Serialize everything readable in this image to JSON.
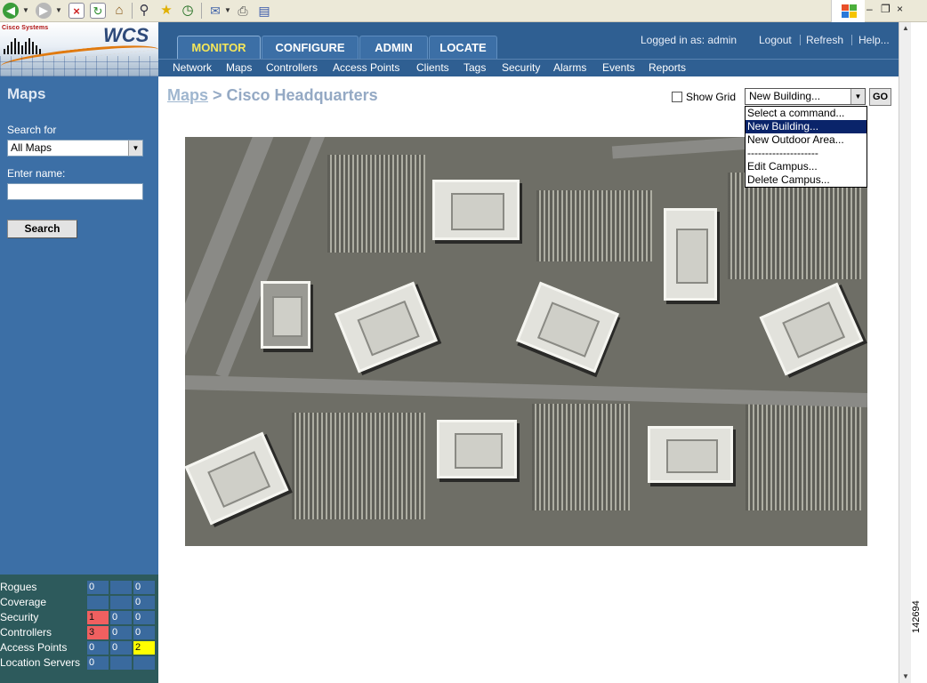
{
  "browser": {
    "icons": [
      "back-icon",
      "forward-icon",
      "stop-icon",
      "refresh-icon",
      "home-icon",
      "search-icon",
      "favorites-icon",
      "history-icon",
      "mail-icon",
      "print-icon",
      "edit-icon"
    ]
  },
  "header": {
    "logo_company": "Cisco Systems",
    "logo_product": "WCS",
    "tabs": [
      {
        "label": "MONITOR",
        "active": true
      },
      {
        "label": "CONFIGURE",
        "active": false
      },
      {
        "label": "ADMIN",
        "active": false
      },
      {
        "label": "LOCATE",
        "active": false
      }
    ],
    "logged_in": "Logged in as: admin",
    "logout": "Logout",
    "refresh": "Refresh",
    "help": "Help..."
  },
  "subnav": [
    "Network",
    "Maps",
    "Controllers",
    "Access Points",
    "Clients",
    "Tags",
    "Security",
    "Alarms",
    "Events",
    "Reports"
  ],
  "sidebar": {
    "title": "Maps",
    "search_for_label": "Search for",
    "search_for_value": "All Maps",
    "enter_name_label": "Enter name:",
    "enter_name_value": "",
    "search_button": "Search"
  },
  "alarm_summary": [
    {
      "name": "Rogues",
      "critical": "0",
      "major": "",
      "minor": "0"
    },
    {
      "name": "Coverage",
      "critical": "",
      "major": "",
      "minor": "0"
    },
    {
      "name": "Security",
      "critical": "1",
      "major": "0",
      "minor": "0"
    },
    {
      "name": "Controllers",
      "critical": "3",
      "major": "0",
      "minor": "0"
    },
    {
      "name": "Access Points",
      "critical": "0",
      "major": "0",
      "minor": "2"
    },
    {
      "name": "Location Servers",
      "critical": "0",
      "major": "",
      "minor": ""
    }
  ],
  "main": {
    "breadcrumb_link": "Maps",
    "breadcrumb_sep": " > ",
    "breadcrumb_current": "Cisco Headquarters",
    "show_grid_label": "Show Grid",
    "command_selected": "New Building...",
    "go_button": "GO",
    "command_options": [
      "Select a command...",
      "New Building...",
      "New Outdoor Area...",
      "--------------------",
      "Edit Campus...",
      "Delete Campus..."
    ]
  },
  "colors": {
    "header_blue": "#2f5f92",
    "sidebar_blue": "#3c6fa6",
    "active_tab_text": "#f5e65a",
    "alarm_critical": "#f06060",
    "alarm_minor": "#ffff00"
  },
  "figure_number": "142694"
}
